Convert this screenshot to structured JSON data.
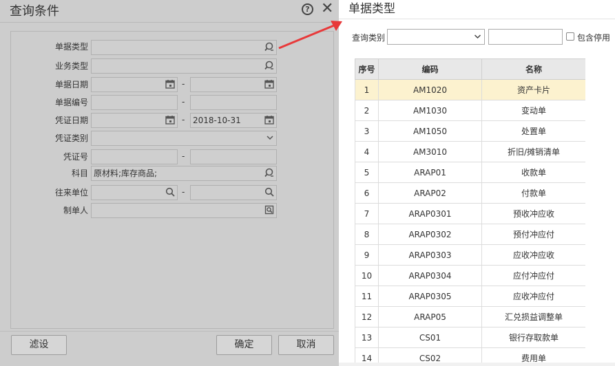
{
  "query_dialog": {
    "title": "查询条件",
    "fields": {
      "doc_type": "单据类型",
      "biz_type": "业务类型",
      "doc_date": "单据日期",
      "doc_no": "单据编号",
      "voucher_date": "凭证日期",
      "voucher_date_to": "2018-10-31",
      "voucher_category": "凭证类别",
      "voucher_no": "凭证号",
      "subject": "科目",
      "subject_value": "原材料;库存商品;",
      "partner": "往来单位",
      "maker": "制单人"
    },
    "range_sep": "-",
    "buttons": {
      "filter": "滤设",
      "confirm": "确定",
      "cancel": "取消"
    }
  },
  "doc_type_panel": {
    "title": "单据类型",
    "query_label": "查询类别",
    "include_disabled_label": "包含停用",
    "columns": {
      "no": "序号",
      "code": "编码",
      "name": "名称"
    },
    "selected_row": 0,
    "rows": [
      {
        "no": "1",
        "code": "AM1020",
        "name": "资产卡片"
      },
      {
        "no": "2",
        "code": "AM1030",
        "name": "变动单"
      },
      {
        "no": "3",
        "code": "AM1050",
        "name": "处置单"
      },
      {
        "no": "4",
        "code": "AM3010",
        "name": "折旧/摊销清单"
      },
      {
        "no": "5",
        "code": "ARAP01",
        "name": "收款单"
      },
      {
        "no": "6",
        "code": "ARAP02",
        "name": "付款单"
      },
      {
        "no": "7",
        "code": "ARAP0301",
        "name": "预收冲应收"
      },
      {
        "no": "8",
        "code": "ARAP0302",
        "name": "预付冲应付"
      },
      {
        "no": "9",
        "code": "ARAP0303",
        "name": "应收冲应收"
      },
      {
        "no": "10",
        "code": "ARAP0304",
        "name": "应付冲应付"
      },
      {
        "no": "11",
        "code": "ARAP0305",
        "name": "应收冲应付"
      },
      {
        "no": "12",
        "code": "ARAP05",
        "name": "汇兑损益调整单"
      },
      {
        "no": "13",
        "code": "CS01",
        "name": "银行存取款单"
      },
      {
        "no": "14",
        "code": "CS02",
        "name": "费用单"
      }
    ]
  },
  "icons": {
    "help": "help-circle-icon",
    "close": "close-icon",
    "lookup": "lookup-search-icon",
    "calendar": "calendar-icon",
    "search": "search-icon",
    "chevron": "chevron-down-icon",
    "person_lookup": "person-lookup-icon"
  },
  "colors": {
    "selected_row": "#fcf2cf",
    "arrow": "#e8393a",
    "dim_bg": "#cdcdcd"
  }
}
